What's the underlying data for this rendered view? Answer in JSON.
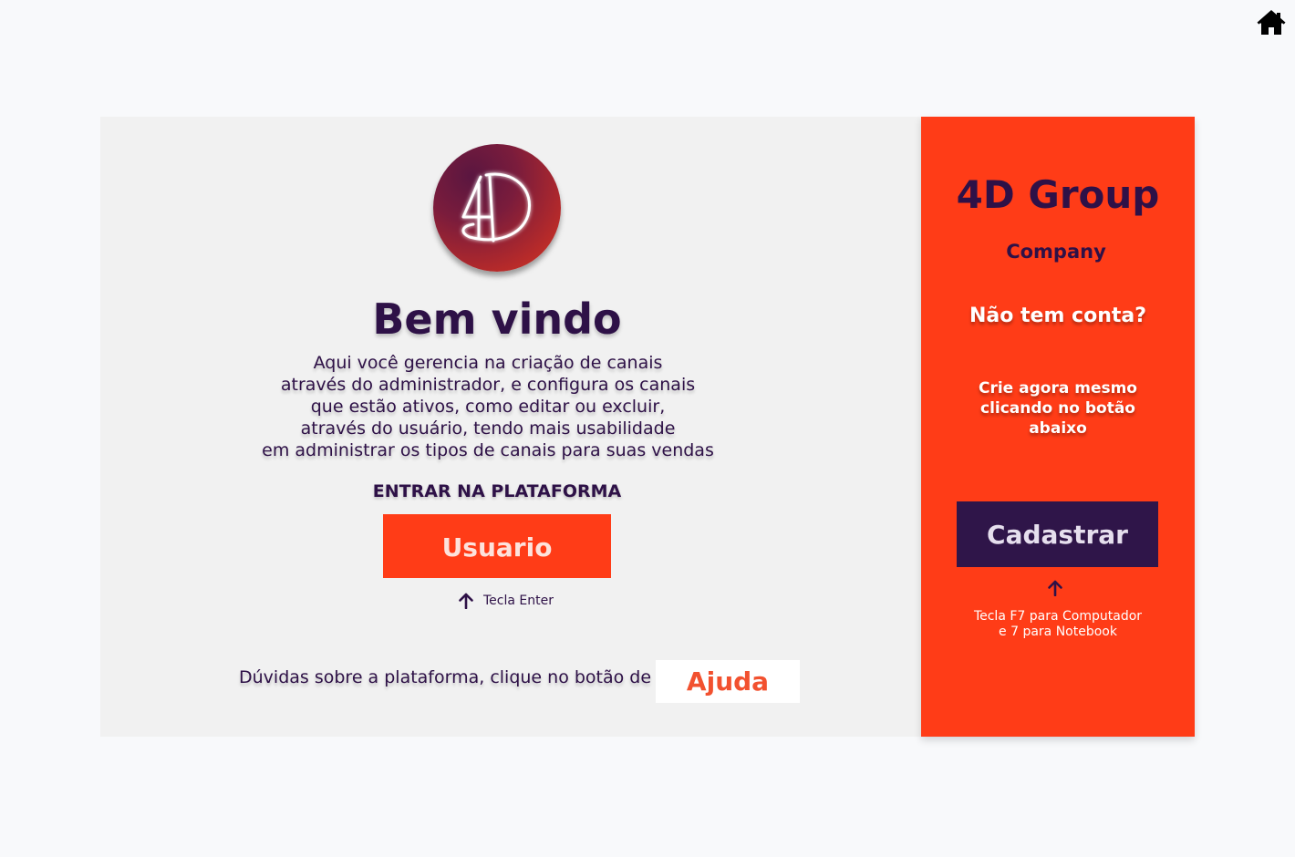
{
  "icons": {
    "home": "home-icon",
    "logo": "4d-logo-icon",
    "arrow_up": "arrow-up-icon"
  },
  "colors": {
    "accent": "#ff3c17",
    "primary_dark": "#2e1147",
    "panel_bg": "#f1f1f1",
    "page_bg": "#f8f9fb"
  },
  "login": {
    "title": "Bem vindo",
    "description_lines": [
      "Aqui você gerencia na criação de canais",
      "através do administrador, e configura os canais",
      "que estão ativos, como editar ou excluir,",
      "através do usuário, tendo mais usabilidade",
      "em administrar os tipos de canais para suas vendas"
    ],
    "enter_label": "ENTRAR NA PLATAFORMA",
    "user_button_label": "Usuario",
    "enter_hint": "Tecla Enter",
    "help_text": "Dúvidas sobre a plataforma, clique no botão de",
    "help_button_label": "Ajuda"
  },
  "signup": {
    "brand_title": "4D Group",
    "brand_subtitle": "Company",
    "no_account": "Não tem conta?",
    "create_lines": [
      "Crie agora mesmo",
      "clicando no botão",
      "abaixo"
    ],
    "register_button_label": "Cadastrar",
    "register_hint_lines": [
      "Tecla F7 para Computador",
      "e 7 para Notebook"
    ]
  }
}
